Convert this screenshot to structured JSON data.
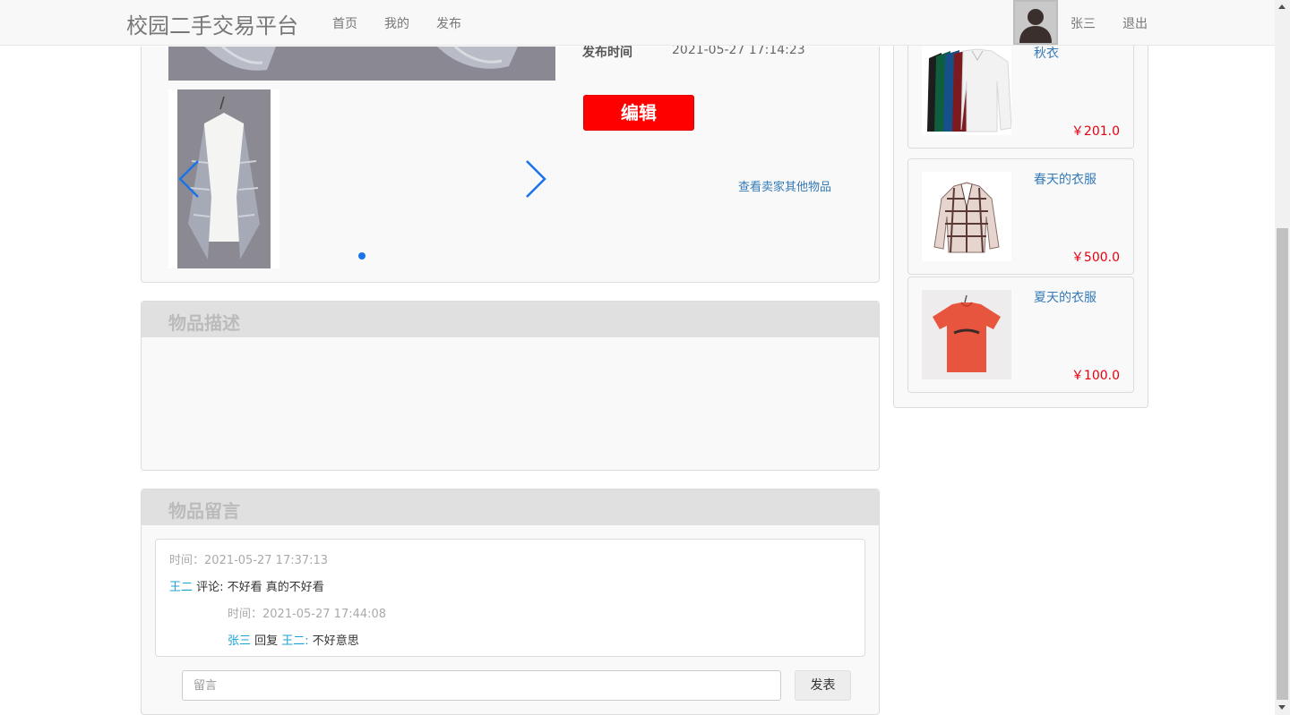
{
  "navbar": {
    "brand": "校园二手交易平台",
    "links": [
      "首页",
      "我的",
      "发布"
    ],
    "username": "张三",
    "logout": "退出"
  },
  "product": {
    "publish_time_label": "发布时间",
    "publish_time": "2021-05-27 17:14:23",
    "edit_label": "编辑",
    "seller_link": "查看卖家其他物品"
  },
  "description": {
    "title": "物品描述"
  },
  "comments": {
    "title": "物品留言",
    "items": [
      {
        "time": "时间：2021-05-27 17:37:13",
        "user": "王二",
        "text": " 评论: 不好看 真的不好看",
        "reply": {
          "time": "时间：2021-05-27 17:44:08",
          "user": "张三",
          "verb": " 回复 ",
          "to": "王二:",
          "text": " 不好意思"
        }
      }
    ],
    "input_placeholder": "留言",
    "submit_label": "发表"
  },
  "related": [
    {
      "title": "秋衣",
      "price": "￥201.0",
      "icon": "long-sleeve-shirts-image"
    },
    {
      "title": "春天的衣服",
      "price": "￥500.0",
      "icon": "plaid-blazer-image"
    },
    {
      "title": "夏天的衣服",
      "price": "￥100.0",
      "icon": "red-tshirt-image"
    }
  ],
  "colors": {
    "accent": "#1a73e8",
    "edit_button": "#ff0000",
    "price": "#e4000f",
    "link": "#337ab7",
    "user": "#1aa2d6"
  }
}
